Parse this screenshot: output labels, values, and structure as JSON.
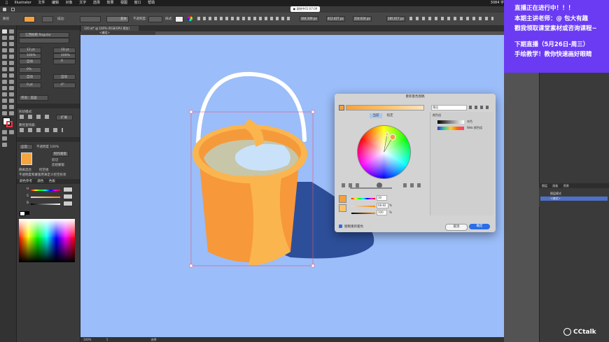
{
  "menubar": {
    "app": "Illustrator",
    "items": [
      "文件",
      "编辑",
      "对象",
      "文字",
      "选择",
      "效果",
      "视图",
      "窗口",
      "帮助"
    ],
    "right": "3084 字"
  },
  "control": {
    "mode_label": "路径",
    "stroke_label": "描边:",
    "style_label": "基本",
    "opacity_label": "不透明度:",
    "style2_label": "样式:",
    "x_value": "304.309 px",
    "y_value": "412.427 px",
    "w_value": "224.024 px",
    "h_value": "285.017 px",
    "record_badge": "● 录制中01:07:09"
  },
  "document": {
    "tab_title": "120 at* @ 100% (RGB/GPU 预览)",
    "sub_tab": "<编组>"
  },
  "left_panel": {
    "font_family": "江西拙楷 Regular",
    "font_size": "12 pt",
    "leading": "18 pt",
    "tracking": "100%",
    "kerning": "100%",
    "auto1": "自动",
    "auto2": "0",
    "percent": "0%",
    "auto3": "自动",
    "auto4": "自动",
    "pt1": "0 pt",
    "deg": "0°",
    "lang": "英语：美国",
    "section_pathfinder": "形状模式:",
    "section_pathfinder2": "路径查找器:",
    "expand_btn": "扩展",
    "opacity_mode": "正常",
    "opacity_value": "不透明度 100%",
    "make_mask": "制作蒙版",
    "clip": "剪切",
    "invert": "反相蒙版",
    "isolate": "隔离混合",
    "knockout": "挖空组",
    "opacity_note": "不透明度和蒙版用来定义挖空形状",
    "color_tabs": [
      "颜色参考",
      "颜色",
      "色板"
    ],
    "h_label": "H",
    "s_label": "S",
    "b_label": "B"
  },
  "dialog": {
    "title": "重新着色图稿",
    "tab_current": "当前",
    "tab_assign": "指定",
    "preset_label": "预设",
    "color_group_label": "颜色组",
    "group1": "灰色",
    "group2": "Web 颜色组",
    "h_value": "30",
    "s_value": "68.82",
    "b_value": "100",
    "unit": "%",
    "recolor_checkbox": "图稿重新着色",
    "cancel": "取消",
    "ok": "确定"
  },
  "layers": {
    "tabs": [
      "图层",
      "画板",
      "资源"
    ],
    "row1": "图层模式",
    "row2": "<编组>"
  },
  "status": {
    "zoom": "100%",
    "page": "1",
    "select": "选择"
  },
  "banner": {
    "line1": "直播正在进行中！！！",
    "line2": "本期主讲老师：@ 包大有趣",
    "line3": "戳我领取课堂素材或咨询课程~",
    "line4": "下期直播（5月26日-周三）",
    "line5": "手绘教学！教你快速画好眼睛"
  },
  "watermark": "CCtalk",
  "colors": {
    "canvas": "#9bbdf9",
    "banner": "#6a3bf2",
    "pail_orange": "#f79a3a",
    "pail_light": "#fbb44d",
    "shadow": "#2d4f9a",
    "ok_button": "#2a6ee6"
  }
}
